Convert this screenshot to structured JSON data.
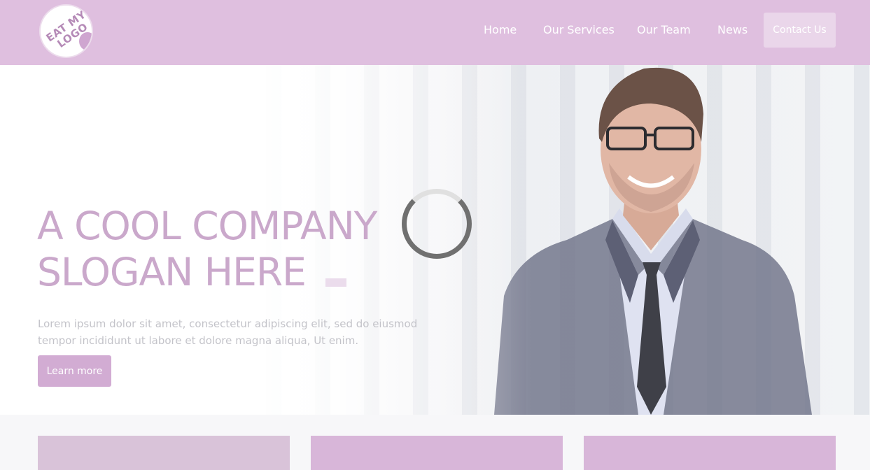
{
  "header": {
    "logo_text": "EAT MY LOGO",
    "nav": [
      {
        "label": "Home"
      },
      {
        "label": "Our Services"
      },
      {
        "label": "Our Team"
      },
      {
        "label": "News"
      }
    ],
    "contact_label": "Contact Us"
  },
  "hero": {
    "slogan_line1": "A COOL COMPANY",
    "slogan_line2": "SLOGAN HERE",
    "description": "Lorem ipsum dolor sit amet, consectetur adipiscing elit, sed do eiusmod tempor incididunt ut labore et dolore magna aliqua, Ut enim.",
    "cta_label": "Learn more"
  },
  "colors": {
    "accent": "#dfbfdf",
    "slogan": "#caa8cb",
    "button": "#d2acd3"
  },
  "icons": {
    "loading": "loading-spinner"
  }
}
